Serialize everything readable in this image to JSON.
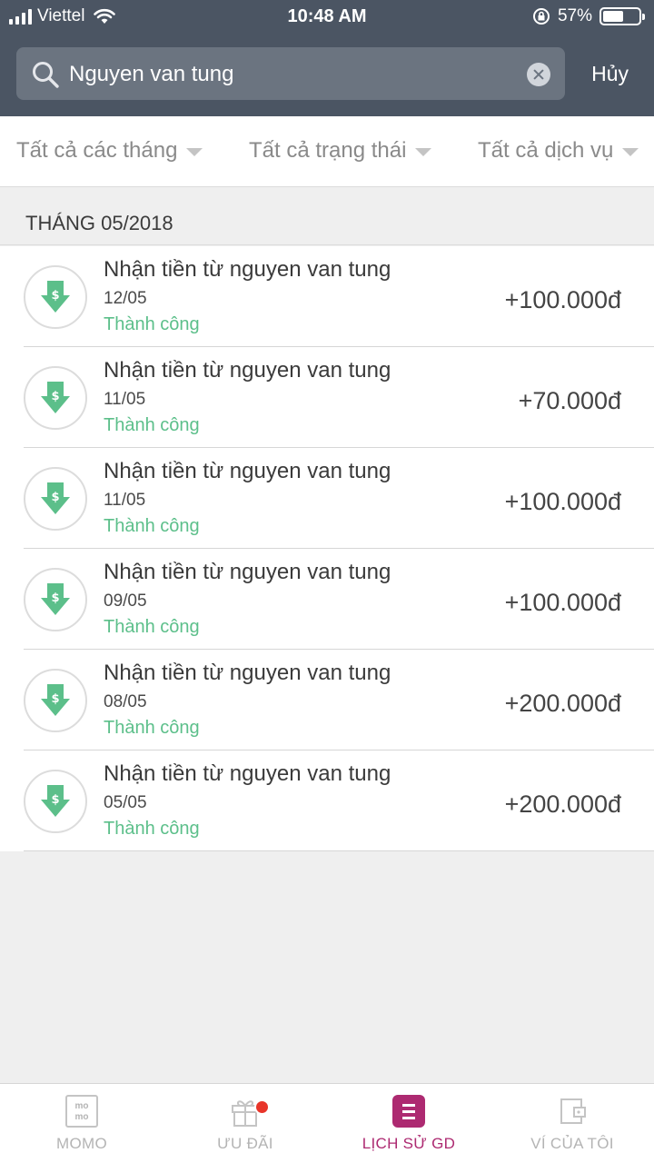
{
  "status_bar": {
    "carrier": "Viettel",
    "time": "10:48 AM",
    "battery": "57%",
    "battery_level": 0.57
  },
  "search": {
    "value": "Nguyen van tung",
    "cancel_label": "Hủy"
  },
  "filters": [
    {
      "label": "Tất cả các tháng"
    },
    {
      "label": "Tất cả trạng thái"
    },
    {
      "label": "Tất cả dịch vụ"
    }
  ],
  "section": {
    "title": "THÁNG 05/2018"
  },
  "transactions": [
    {
      "title": "Nhận tiền từ nguyen van tung",
      "date": "12/05",
      "status": "Thành công",
      "amount": "+100.000đ"
    },
    {
      "title": "Nhận tiền từ nguyen van tung",
      "date": "11/05",
      "status": "Thành công",
      "amount": "+70.000đ"
    },
    {
      "title": "Nhận tiền từ nguyen van tung",
      "date": "11/05",
      "status": "Thành công",
      "amount": "+100.000đ"
    },
    {
      "title": "Nhận tiền từ nguyen van tung",
      "date": "09/05",
      "status": "Thành công",
      "amount": "+100.000đ"
    },
    {
      "title": "Nhận tiền từ nguyen van tung",
      "date": "08/05",
      "status": "Thành công",
      "amount": "+200.000đ"
    },
    {
      "title": "Nhận tiền từ nguyen van tung",
      "date": "05/05",
      "status": "Thành công",
      "amount": "+200.000đ"
    }
  ],
  "tabs": [
    {
      "label": "MOMO",
      "icon": "momo-icon",
      "active": false
    },
    {
      "label": "ƯU ĐÃI",
      "icon": "gift-icon",
      "active": false
    },
    {
      "label": "LỊCH SỬ GD",
      "icon": "history-icon",
      "active": true
    },
    {
      "label": "VÍ CỦA TÔI",
      "icon": "wallet-icon",
      "active": false
    }
  ],
  "colors": {
    "header": "#4b5563",
    "success": "#5cbf8a",
    "accent": "#ad2a71",
    "receive_icon": "#5cbf8a"
  }
}
